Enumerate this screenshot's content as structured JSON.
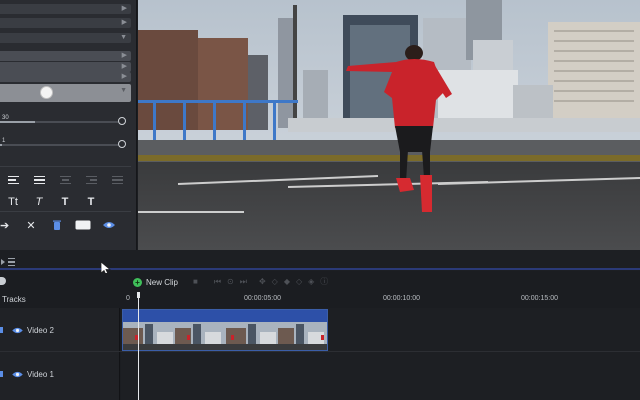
{
  "timeline": {
    "new_clip_label": "New Clip",
    "tracks_label": "Tracks",
    "ruler_labels": [
      "0",
      "00:00:05:00",
      "00:00:10:00",
      "00:00:15:00"
    ],
    "tracks": [
      {
        "name": "Video 2"
      },
      {
        "name": "Video 1"
      }
    ]
  },
  "properties": {
    "slider_1_value": "30",
    "slider_2_value": "1",
    "text_tool_labels": [
      "Tt",
      "T",
      "T",
      "T"
    ]
  },
  "colors": {
    "accent_blue": "#2d50a8",
    "new_clip_green": "#3fbf5a",
    "panel_bg": "#2a2c31"
  }
}
